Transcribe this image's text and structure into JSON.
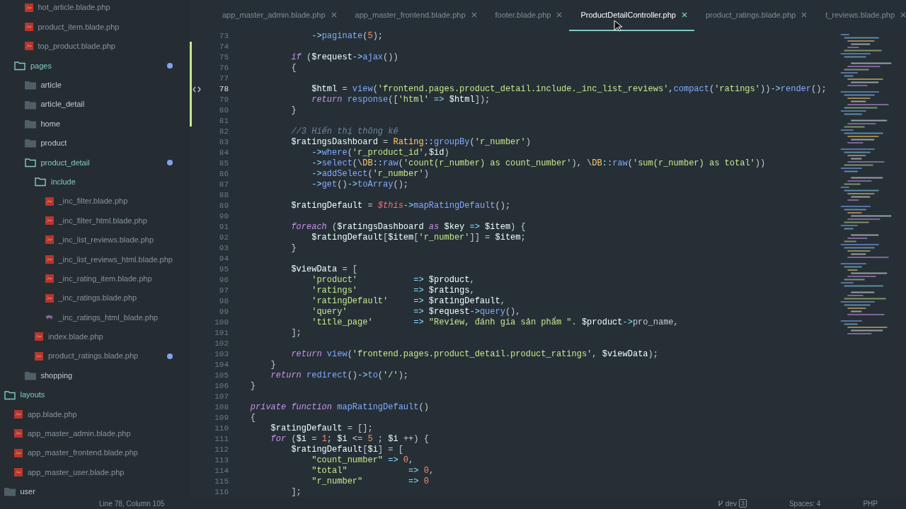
{
  "sidebar": {
    "tree": [
      {
        "kind": "group",
        "children": [
          {
            "kind": "group",
            "children": [
              {
                "kind": "blade_file",
                "label": "hot_article.blade.php",
                "modified": false
              },
              {
                "kind": "blade_file",
                "label": "product_item.blade.php",
                "modified": false
              },
              {
                "kind": "blade_file",
                "label": "top_product.blade.php",
                "modified": false
              }
            ]
          },
          {
            "kind": "folder",
            "label": "pages",
            "expanded": true,
            "modified": true,
            "children": [
              {
                "kind": "folder",
                "label": "article",
                "expanded": false,
                "modified": false
              },
              {
                "kind": "folder",
                "label": "article_detail",
                "expanded": false,
                "modified": false
              },
              {
                "kind": "folder",
                "label": "home",
                "expanded": false,
                "modified": false
              },
              {
                "kind": "folder",
                "label": "product",
                "expanded": false,
                "modified": false
              },
              {
                "kind": "folder",
                "label": "product_detail",
                "expanded": true,
                "modified": true,
                "children": [
                  {
                    "kind": "folder",
                    "label": "include",
                    "expanded": true,
                    "modified": false,
                    "children": [
                      {
                        "kind": "blade_file",
                        "label": "_inc_filter.blade.php",
                        "modified": false
                      },
                      {
                        "kind": "blade_file",
                        "label": "_inc_filter_html.blade.php",
                        "modified": false
                      },
                      {
                        "kind": "blade_file",
                        "label": "_inc_list_reviews.blade.php",
                        "modified": false
                      },
                      {
                        "kind": "blade_file",
                        "label": "_inc_list_reviews_html.blade.php",
                        "modified": false
                      },
                      {
                        "kind": "blade_file",
                        "label": "_inc_rating_item.blade.php",
                        "modified": false
                      },
                      {
                        "kind": "blade_file",
                        "label": "_inc_ratings.blade.php",
                        "modified": false
                      },
                      {
                        "kind": "php_file",
                        "label": "_inc_ratings_html_blade.php",
                        "modified": false
                      }
                    ]
                  },
                  {
                    "kind": "blade_file",
                    "label": "index.blade.php",
                    "modified": false
                  },
                  {
                    "kind": "blade_file",
                    "label": "product_ratings.blade.php",
                    "modified": true
                  }
                ]
              },
              {
                "kind": "folder",
                "label": "shopping",
                "expanded": false,
                "modified": false
              }
            ]
          }
        ]
      },
      {
        "kind": "folder",
        "label": "layouts",
        "expanded": true,
        "modified": false,
        "children": [
          {
            "kind": "blade_file",
            "label": "app.blade.php",
            "modified": false
          },
          {
            "kind": "blade_file",
            "label": "app_master_admin.blade.php",
            "modified": false
          },
          {
            "kind": "blade_file",
            "label": "app_master_frontend.blade.php",
            "modified": false
          },
          {
            "kind": "blade_file",
            "label": "app_master_user.blade.php",
            "modified": false
          }
        ]
      },
      {
        "kind": "folder",
        "label": "user",
        "expanded": false,
        "modified": false
      }
    ]
  },
  "editor": {
    "tabs": [
      {
        "label": "app_master_admin.blade.php",
        "selected": false
      },
      {
        "label": "app_master_frontend.blade.php",
        "selected": false
      },
      {
        "label": "footer.blade.php",
        "selected": false
      },
      {
        "label": "ProductDetailController.php",
        "selected": true
      },
      {
        "label": "product_ratings.blade.php",
        "selected": false
      },
      {
        "label": "t_reviews.blade.php",
        "selected": false
      }
    ],
    "lines": [
      {
        "number": "73",
        "modified": false,
        "current": false,
        "tokens": [
          {
            "kind": "op",
            "text": "                ->"
          },
          {
            "kind": "func",
            "text": "paginate"
          },
          {
            "kind": "plain",
            "text": "("
          },
          {
            "kind": "number",
            "text": "5"
          },
          {
            "kind": "plain",
            "text": ");"
          }
        ]
      },
      {
        "number": "74",
        "modified": true,
        "current": false
      },
      {
        "number": "75",
        "modified": true,
        "current": false,
        "tokens": [
          {
            "kind": "keyword",
            "text": "            if"
          },
          {
            "kind": "plain",
            "text": " ("
          },
          {
            "kind": "var",
            "text": "$request"
          },
          {
            "kind": "op",
            "text": "->"
          },
          {
            "kind": "func",
            "text": "ajax"
          },
          {
            "kind": "plain",
            "text": "())"
          }
        ]
      },
      {
        "number": "76",
        "modified": true,
        "current": false,
        "tokens": [
          {
            "kind": "plain",
            "text": "            {"
          }
        ]
      },
      {
        "number": "77",
        "modified": true,
        "current": false
      },
      {
        "number": "78",
        "modified": true,
        "current": true,
        "tokens": [
          {
            "kind": "var",
            "text": "                $html"
          },
          {
            "kind": "plain",
            "text": " = "
          },
          {
            "kind": "func",
            "text": "view"
          },
          {
            "kind": "plain",
            "text": "("
          },
          {
            "kind": "string",
            "text": "'frontend.pages.product_detail.include._inc_list_reviews'"
          },
          {
            "kind": "plain",
            "text": ","
          },
          {
            "kind": "func",
            "text": "compact"
          },
          {
            "kind": "plain",
            "text": "("
          },
          {
            "kind": "string",
            "text": "'ratings'"
          },
          {
            "kind": "plain",
            "text": "))"
          },
          {
            "kind": "op",
            "text": "->"
          },
          {
            "kind": "func",
            "text": "render"
          },
          {
            "kind": "plain",
            "text": "();"
          }
        ]
      },
      {
        "number": "79",
        "modified": true,
        "current": false,
        "tokens": [
          {
            "kind": "keyword",
            "text": "                return"
          },
          {
            "kind": "func",
            "text": " response"
          },
          {
            "kind": "plain",
            "text": "(["
          },
          {
            "kind": "string",
            "text": "'html'"
          },
          {
            "kind": "op",
            "text": " => "
          },
          {
            "kind": "var",
            "text": "$html"
          },
          {
            "kind": "plain",
            "text": "]);"
          }
        ]
      },
      {
        "number": "80",
        "modified": true,
        "current": false,
        "tokens": [
          {
            "kind": "plain",
            "text": "            }"
          }
        ]
      },
      {
        "number": "81",
        "modified": true,
        "current": false
      },
      {
        "number": "82",
        "modified": false,
        "current": false,
        "tokens": [
          {
            "kind": "comment",
            "text": "            //3 Hiển thị thông kê"
          }
        ]
      },
      {
        "number": "83",
        "modified": false,
        "current": false,
        "tokens": [
          {
            "kind": "var",
            "text": "            $ratingsDashboard"
          },
          {
            "kind": "plain",
            "text": " = "
          },
          {
            "kind": "class",
            "text": "Rating"
          },
          {
            "kind": "op",
            "text": "::"
          },
          {
            "kind": "func",
            "text": "groupBy"
          },
          {
            "kind": "plain",
            "text": "("
          },
          {
            "kind": "string",
            "text": "'r_number'"
          },
          {
            "kind": "plain",
            "text": ")"
          }
        ]
      },
      {
        "number": "84",
        "modified": false,
        "current": false,
        "tokens": [
          {
            "kind": "op",
            "text": "                ->"
          },
          {
            "kind": "func",
            "text": "where"
          },
          {
            "kind": "plain",
            "text": "("
          },
          {
            "kind": "string",
            "text": "'r_product_id'"
          },
          {
            "kind": "plain",
            "text": ","
          },
          {
            "kind": "var",
            "text": "$id"
          },
          {
            "kind": "plain",
            "text": ")"
          }
        ]
      },
      {
        "number": "85",
        "modified": false,
        "current": false,
        "tokens": [
          {
            "kind": "op",
            "text": "                ->"
          },
          {
            "kind": "func",
            "text": "select"
          },
          {
            "kind": "plain",
            "text": "(\\"
          },
          {
            "kind": "class",
            "text": "DB"
          },
          {
            "kind": "op",
            "text": "::"
          },
          {
            "kind": "func",
            "text": "raw"
          },
          {
            "kind": "plain",
            "text": "("
          },
          {
            "kind": "string",
            "text": "'count(r_number) as count_number'"
          },
          {
            "kind": "plain",
            "text": "), \\"
          },
          {
            "kind": "class",
            "text": "DB"
          },
          {
            "kind": "op",
            "text": "::"
          },
          {
            "kind": "func",
            "text": "raw"
          },
          {
            "kind": "plain",
            "text": "("
          },
          {
            "kind": "string",
            "text": "'sum(r_number) as total'"
          },
          {
            "kind": "plain",
            "text": "))"
          }
        ]
      },
      {
        "number": "86",
        "modified": false,
        "current": false,
        "tokens": [
          {
            "kind": "op",
            "text": "                ->"
          },
          {
            "kind": "func",
            "text": "addSelect"
          },
          {
            "kind": "plain",
            "text": "("
          },
          {
            "kind": "string",
            "text": "'r_number'"
          },
          {
            "kind": "plain",
            "text": ")"
          }
        ]
      },
      {
        "number": "87",
        "modified": false,
        "current": false,
        "tokens": [
          {
            "kind": "op",
            "text": "                ->"
          },
          {
            "kind": "func",
            "text": "get"
          },
          {
            "kind": "plain",
            "text": "()"
          },
          {
            "kind": "op",
            "text": "->"
          },
          {
            "kind": "func",
            "text": "toArray"
          },
          {
            "kind": "plain",
            "text": "();"
          }
        ]
      },
      {
        "number": "88",
        "modified": false,
        "current": false
      },
      {
        "number": "89",
        "modified": false,
        "current": false,
        "tokens": [
          {
            "kind": "var",
            "text": "            $ratingDefault"
          },
          {
            "kind": "plain",
            "text": " = "
          },
          {
            "kind": "this",
            "text": "$this"
          },
          {
            "kind": "op",
            "text": "->"
          },
          {
            "kind": "func",
            "text": "mapRatingDefault"
          },
          {
            "kind": "plain",
            "text": "();"
          }
        ]
      },
      {
        "number": "90",
        "modified": false,
        "current": false
      },
      {
        "number": "91",
        "modified": false,
        "current": false,
        "tokens": [
          {
            "kind": "keyword",
            "text": "            foreach"
          },
          {
            "kind": "plain",
            "text": " ("
          },
          {
            "kind": "var",
            "text": "$ratingsDashboard"
          },
          {
            "kind": "keyword",
            "text": " as "
          },
          {
            "kind": "var",
            "text": "$key"
          },
          {
            "kind": "op",
            "text": " => "
          },
          {
            "kind": "var",
            "text": "$item"
          },
          {
            "kind": "plain",
            "text": ") {"
          }
        ]
      },
      {
        "number": "92",
        "modified": false,
        "current": false,
        "tokens": [
          {
            "kind": "var",
            "text": "                $ratingDefault"
          },
          {
            "kind": "plain",
            "text": "["
          },
          {
            "kind": "var",
            "text": "$item"
          },
          {
            "kind": "plain",
            "text": "["
          },
          {
            "kind": "string",
            "text": "'r_number'"
          },
          {
            "kind": "plain",
            "text": "]] = "
          },
          {
            "kind": "var",
            "text": "$item"
          },
          {
            "kind": "plain",
            "text": ";"
          }
        ]
      },
      {
        "number": "93",
        "modified": false,
        "current": false,
        "tokens": [
          {
            "kind": "plain",
            "text": "            }"
          }
        ]
      },
      {
        "number": "94",
        "modified": false,
        "current": false
      },
      {
        "number": "95",
        "modified": false,
        "current": false,
        "tokens": [
          {
            "kind": "var",
            "text": "            $viewData"
          },
          {
            "kind": "plain",
            "text": " = ["
          }
        ]
      },
      {
        "number": "96",
        "modified": false,
        "current": false,
        "tokens": [
          {
            "kind": "string",
            "text": "                'product'"
          },
          {
            "kind": "op",
            "text": "           => "
          },
          {
            "kind": "var",
            "text": "$product"
          },
          {
            "kind": "plain",
            "text": ","
          }
        ]
      },
      {
        "number": "97",
        "modified": false,
        "current": false,
        "tokens": [
          {
            "kind": "string",
            "text": "                'ratings'"
          },
          {
            "kind": "op",
            "text": "           => "
          },
          {
            "kind": "var",
            "text": "$ratings"
          },
          {
            "kind": "plain",
            "text": ","
          }
        ]
      },
      {
        "number": "98",
        "modified": false,
        "current": false,
        "tokens": [
          {
            "kind": "string",
            "text": "                'ratingDefault'"
          },
          {
            "kind": "op",
            "text": "     => "
          },
          {
            "kind": "var",
            "text": "$ratingDefault"
          },
          {
            "kind": "plain",
            "text": ","
          }
        ]
      },
      {
        "number": "99",
        "modified": false,
        "current": false,
        "tokens": [
          {
            "kind": "string",
            "text": "                'query'"
          },
          {
            "kind": "op",
            "text": "             => "
          },
          {
            "kind": "var",
            "text": "$request"
          },
          {
            "kind": "op",
            "text": "->"
          },
          {
            "kind": "func",
            "text": "query"
          },
          {
            "kind": "plain",
            "text": "(),"
          }
        ]
      },
      {
        "number": "100",
        "modified": false,
        "current": false,
        "tokens": [
          {
            "kind": "string",
            "text": "                'title_page'"
          },
          {
            "kind": "op",
            "text": "        => "
          },
          {
            "kind": "string",
            "text": "\"Review, đánh gía sản phẩm \""
          },
          {
            "kind": "plain",
            "text": ". "
          },
          {
            "kind": "var",
            "text": "$product"
          },
          {
            "kind": "op",
            "text": "->"
          },
          {
            "kind": "plain",
            "text": "pro_name,"
          }
        ]
      },
      {
        "number": "101",
        "modified": false,
        "current": false,
        "tokens": [
          {
            "kind": "plain",
            "text": "            ];"
          }
        ]
      },
      {
        "number": "102",
        "modified": false,
        "current": false
      },
      {
        "number": "103",
        "modified": false,
        "current": false,
        "tokens": [
          {
            "kind": "keyword",
            "text": "            return"
          },
          {
            "kind": "func",
            "text": " view"
          },
          {
            "kind": "plain",
            "text": "("
          },
          {
            "kind": "string",
            "text": "'frontend.pages.product_detail.product_ratings'"
          },
          {
            "kind": "plain",
            "text": ", "
          },
          {
            "kind": "var",
            "text": "$viewData"
          },
          {
            "kind": "plain",
            "text": ");"
          }
        ]
      },
      {
        "number": "104",
        "modified": false,
        "current": false,
        "tokens": [
          {
            "kind": "plain",
            "text": "        }"
          }
        ]
      },
      {
        "number": "105",
        "modified": false,
        "current": false,
        "tokens": [
          {
            "kind": "keyword",
            "text": "        return"
          },
          {
            "kind": "func",
            "text": " redirect"
          },
          {
            "kind": "plain",
            "text": "()"
          },
          {
            "kind": "op",
            "text": "->"
          },
          {
            "kind": "func",
            "text": "to"
          },
          {
            "kind": "plain",
            "text": "("
          },
          {
            "kind": "string",
            "text": "'/'"
          },
          {
            "kind": "plain",
            "text": ");"
          }
        ]
      },
      {
        "number": "106",
        "modified": false,
        "current": false,
        "tokens": [
          {
            "kind": "plain",
            "text": "    }"
          }
        ]
      },
      {
        "number": "107",
        "modified": false,
        "current": false
      },
      {
        "number": "108",
        "modified": false,
        "current": false,
        "tokens": [
          {
            "kind": "keyword",
            "text": "    private function"
          },
          {
            "kind": "func",
            "text": " mapRatingDefault"
          },
          {
            "kind": "plain",
            "text": "()"
          }
        ]
      },
      {
        "number": "109",
        "modified": false,
        "current": false,
        "tokens": [
          {
            "kind": "plain",
            "text": "    {"
          }
        ]
      },
      {
        "number": "110",
        "modified": false,
        "current": false,
        "tokens": [
          {
            "kind": "var",
            "text": "        $ratingDefault"
          },
          {
            "kind": "plain",
            "text": " = [];"
          }
        ]
      },
      {
        "number": "111",
        "modified": false,
        "current": false,
        "tokens": [
          {
            "kind": "keyword",
            "text": "        for"
          },
          {
            "kind": "plain",
            "text": " ("
          },
          {
            "kind": "var",
            "text": "$i"
          },
          {
            "kind": "plain",
            "text": " = "
          },
          {
            "kind": "number",
            "text": "1"
          },
          {
            "kind": "plain",
            "text": "; "
          },
          {
            "kind": "var",
            "text": "$i"
          },
          {
            "kind": "plain",
            "text": " <= "
          },
          {
            "kind": "number",
            "text": "5"
          },
          {
            "kind": "plain",
            "text": " ; "
          },
          {
            "kind": "var",
            "text": "$i"
          },
          {
            "kind": "plain",
            "text": " ++) {"
          }
        ]
      },
      {
        "number": "112",
        "modified": false,
        "current": false,
        "tokens": [
          {
            "kind": "var",
            "text": "            $ratingDefault"
          },
          {
            "kind": "plain",
            "text": "["
          },
          {
            "kind": "var",
            "text": "$i"
          },
          {
            "kind": "plain",
            "text": "] = ["
          }
        ]
      },
      {
        "number": "113",
        "modified": false,
        "current": false,
        "tokens": [
          {
            "kind": "string",
            "text": "                \"count_number\""
          },
          {
            "kind": "op",
            "text": " => "
          },
          {
            "kind": "number",
            "text": "0"
          },
          {
            "kind": "plain",
            "text": ","
          }
        ]
      },
      {
        "number": "114",
        "modified": false,
        "current": false,
        "tokens": [
          {
            "kind": "string",
            "text": "                \"total\""
          },
          {
            "kind": "op",
            "text": "            => "
          },
          {
            "kind": "number",
            "text": "0"
          },
          {
            "kind": "plain",
            "text": ","
          }
        ]
      },
      {
        "number": "115",
        "modified": false,
        "current": false,
        "tokens": [
          {
            "kind": "string",
            "text": "                \"r_number\""
          },
          {
            "kind": "op",
            "text": "         => "
          },
          {
            "kind": "number",
            "text": "0"
          }
        ]
      },
      {
        "number": "116",
        "modified": false,
        "current": false,
        "tokens": [
          {
            "kind": "plain",
            "text": "            ];"
          }
        ]
      }
    ]
  },
  "status_bar": {
    "position": "Line 78, Column 105",
    "branch": "dev",
    "branch_badge": "3",
    "indentation": "Spaces: 4",
    "language": "PHP"
  }
}
